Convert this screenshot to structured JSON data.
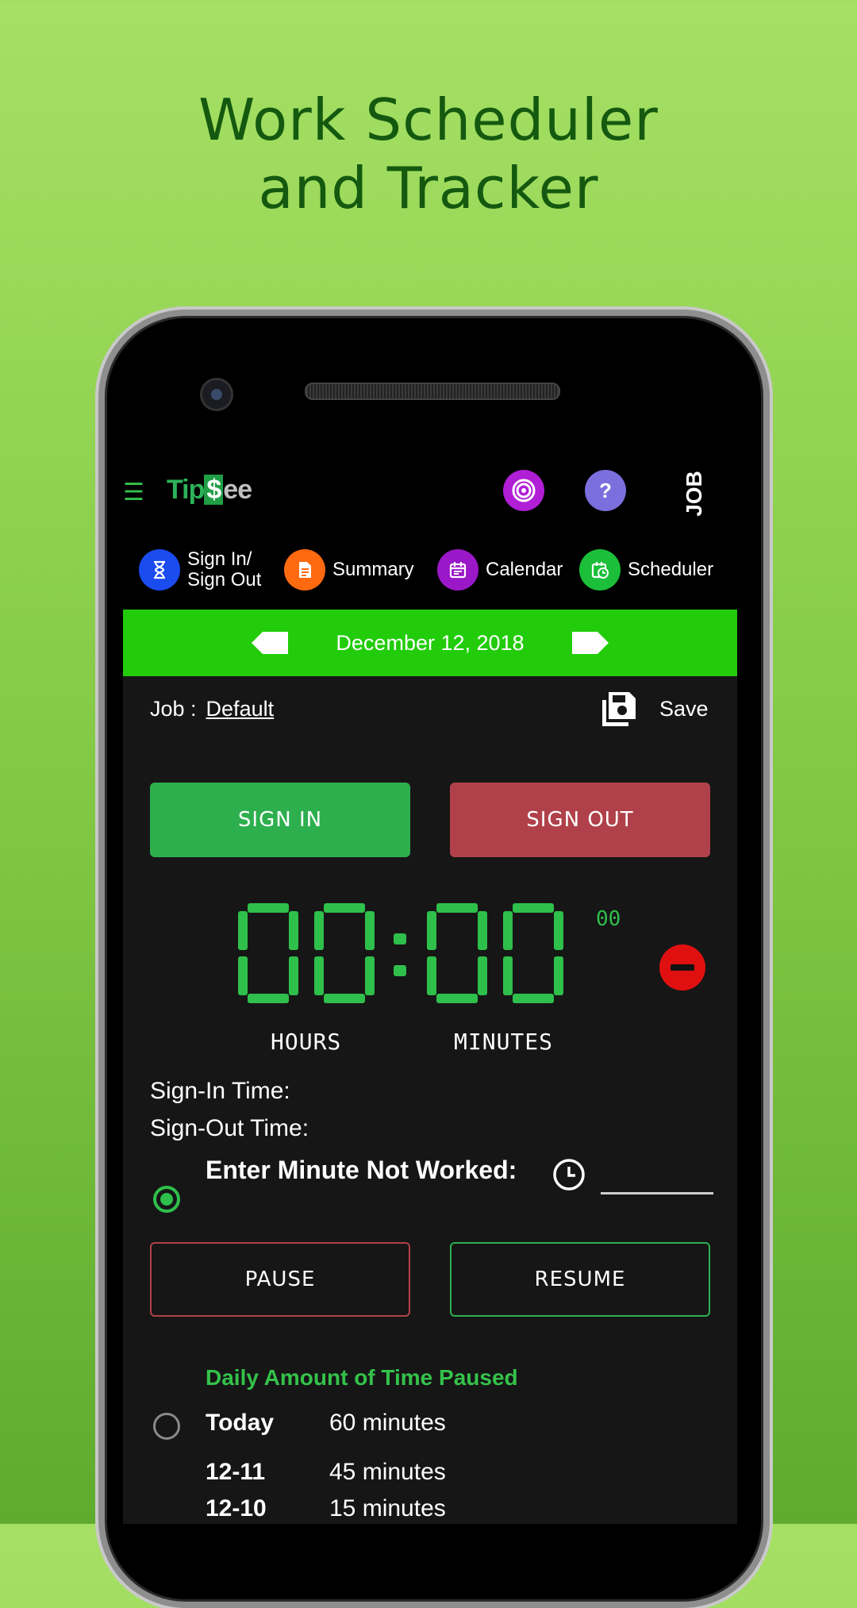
{
  "promo": {
    "line1": "Work Scheduler",
    "line2": "and Tracker"
  },
  "app": {
    "logo": {
      "tip": "Tip",
      "dollar": "$",
      "ee": "ee"
    },
    "help_label": "?",
    "job_label": "JOB",
    "tabs": [
      {
        "line1": "Sign In/",
        "line2": "Sign Out",
        "color": "#1a4cf0"
      },
      {
        "line1": "Summary",
        "color": "#ff6a10"
      },
      {
        "line1": "Calendar",
        "color": "#9b18c9"
      },
      {
        "line1": "Scheduler",
        "color": "#1bbf3a"
      }
    ],
    "date": "December 12, 2018",
    "job": {
      "label": "Job :",
      "value": "Default"
    },
    "save_label": "Save",
    "sign_in_label": "SIGN IN",
    "sign_out_label": "SIGN OUT",
    "timer": {
      "hours": "00",
      "minutes": "00",
      "seconds": "00",
      "hours_label": "HOURS",
      "minutes_label": "MINUTES"
    },
    "sign_in_time_label": "Sign-In Time:",
    "sign_out_time_label": "Sign-Out Time:",
    "minute_not_worked_label": "Enter Minute Not Worked:",
    "minute_not_worked_value": "",
    "pause_label": "PAUSE",
    "resume_label": "RESUME",
    "daily_title": "Daily Amount of Time Paused",
    "paused_rows": [
      {
        "label": "Today",
        "value": "60 minutes"
      },
      {
        "label": "12-11",
        "value": "45 minutes"
      },
      {
        "label": "12-10",
        "value": "15 minutes"
      }
    ],
    "colors": {
      "accent_green": "#22cc0a",
      "sign_in": "#2daf4e",
      "sign_out": "#b0414a",
      "timer_green": "#2fbf4b"
    }
  }
}
